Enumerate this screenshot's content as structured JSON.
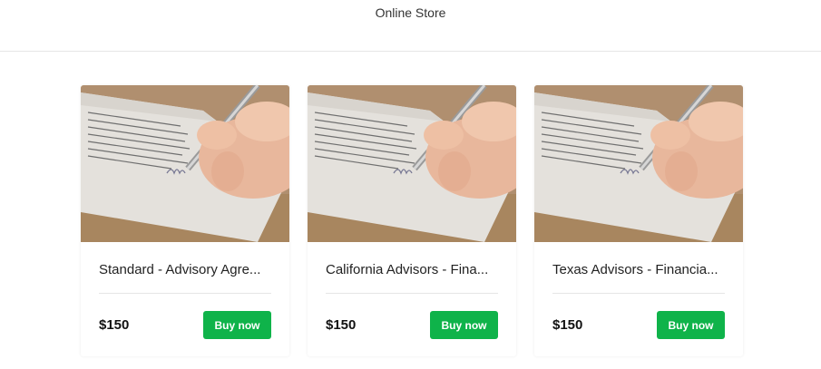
{
  "header": {
    "title": "Online Store"
  },
  "products": [
    {
      "title": "Standard - Advisory Agre...",
      "price": "$150",
      "buy_label": "Buy now",
      "image": "document-signing-photo"
    },
    {
      "title": "California Advisors - Fina...",
      "price": "$150",
      "buy_label": "Buy now",
      "image": "document-signing-photo"
    },
    {
      "title": "Texas Advisors - Financia...",
      "price": "$150",
      "buy_label": "Buy now",
      "image": "document-signing-photo"
    }
  ],
  "colors": {
    "buy_button": "#0fb34a",
    "divider": "#e6e6e6"
  }
}
